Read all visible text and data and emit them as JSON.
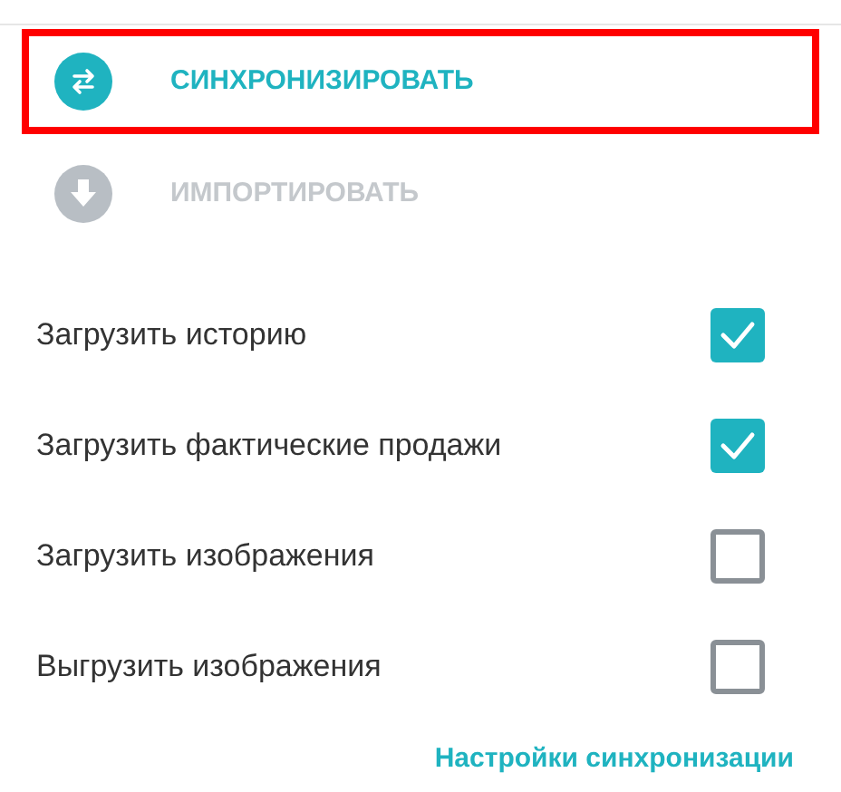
{
  "actions": [
    {
      "kind": "sync",
      "label": "СИНХРОНИЗИРОВАТЬ",
      "disabled": false,
      "highlighted": true
    },
    {
      "kind": "import",
      "label": "ИМПОРТИРОВАТЬ",
      "disabled": true,
      "highlighted": false
    }
  ],
  "options": [
    {
      "label": "Загрузить историю",
      "checked": true
    },
    {
      "label": "Загрузить фактические продажи",
      "checked": true
    },
    {
      "label": "Загрузить изображения",
      "checked": false
    },
    {
      "label": "Выгрузить изображения",
      "checked": false
    }
  ],
  "settings_link": "Настройки синхронизации"
}
